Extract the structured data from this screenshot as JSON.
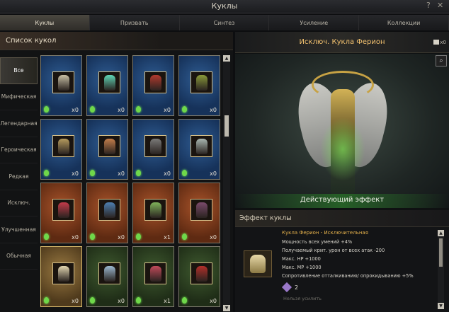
{
  "window": {
    "title": "Куклы",
    "help": "?",
    "close": "✕"
  },
  "tabs": [
    {
      "label": "Куклы",
      "active": true
    },
    {
      "label": "Призвать",
      "active": false
    },
    {
      "label": "Синтез",
      "active": false
    },
    {
      "label": "Усиление",
      "active": false
    },
    {
      "label": "Коллекции",
      "active": false
    }
  ],
  "list": {
    "title": "Список кукол",
    "categories": [
      "Все",
      "Мифическая",
      "Легендарная",
      "Героическая",
      "Редкая",
      "Исключ.",
      "Улучшенная",
      "Обычная"
    ],
    "active_category": "Все",
    "cards": [
      {
        "tier": "blue",
        "qty": "x0",
        "color": "#c9c0a5"
      },
      {
        "tier": "blue",
        "qty": "x0",
        "color": "#5fd6b6"
      },
      {
        "tier": "blue",
        "qty": "x0",
        "color": "#b23a2e"
      },
      {
        "tier": "blue",
        "qty": "x0",
        "color": "#8a9a3a"
      },
      {
        "tier": "blue",
        "qty": "x0",
        "color": "#b59b5e"
      },
      {
        "tier": "blue",
        "qty": "x0",
        "color": "#c27c4a"
      },
      {
        "tier": "blue",
        "qty": "x0",
        "color": "#7a7a78"
      },
      {
        "tier": "blue",
        "qty": "x0",
        "color": "#a9b7b0"
      },
      {
        "tier": "orange",
        "qty": "x0",
        "color": "#c33b4a"
      },
      {
        "tier": "orange",
        "qty": "x0",
        "color": "#4e7fb0"
      },
      {
        "tier": "orange",
        "qty": "x1",
        "color": "#7fb25a"
      },
      {
        "tier": "orange",
        "qty": "x0",
        "color": "#7a4a6a"
      },
      {
        "tier": "gold",
        "qty": "x0",
        "color": "#e2d6b0"
      },
      {
        "tier": "green",
        "qty": "x0",
        "color": "#9bb8d0"
      },
      {
        "tier": "green",
        "qty": "x1",
        "color": "#c14a5a"
      },
      {
        "tier": "green",
        "qty": "x0",
        "color": "#b3302a"
      }
    ]
  },
  "detail": {
    "doll_name": "Исключ. Кукла Ферион",
    "count": "x0",
    "effect_label": "Действующий эффект",
    "effect_title": "Эффект куклы",
    "effect_name": "Кукла Ферион - Исключительная",
    "stats": [
      "Мощность всех умений +4%",
      "Получаемый крит. урон от всех атак -200",
      "Макс. HP +1000",
      "Макс. MP +1000",
      "Сопротивление отталкиванию/ опрокидыванию +5%"
    ],
    "stack_count": "2",
    "cant_enhance": "Нельзя усилить"
  },
  "colors": {
    "accent": "#f2c16f",
    "gem": "#6fd84a",
    "effect_name": "#e6b24c"
  },
  "icons": [
    "search-icon",
    "bag-icon",
    "question-icon",
    "close-icon",
    "gem-icon",
    "star-icon"
  ]
}
